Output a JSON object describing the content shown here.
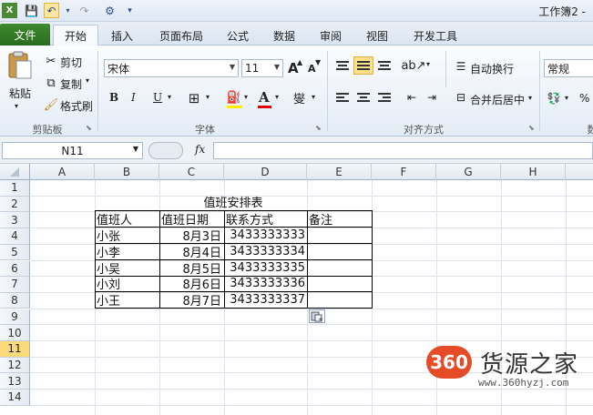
{
  "window": {
    "title": "工作簿2 -"
  },
  "quick_access": {
    "save": "💾",
    "undo": "↶",
    "redo": "↷",
    "extra": "⚙",
    "more": "▾"
  },
  "tabs": [
    {
      "label": "文件"
    },
    {
      "label": "开始"
    },
    {
      "label": "插入"
    },
    {
      "label": "页面布局"
    },
    {
      "label": "公式"
    },
    {
      "label": "数据"
    },
    {
      "label": "审阅"
    },
    {
      "label": "视图"
    },
    {
      "label": "开发工具"
    }
  ],
  "ribbon": {
    "clipboard": {
      "paste": "粘贴",
      "cut": "剪切",
      "copy": "复制",
      "format_painter": "格式刷",
      "group": "剪贴板"
    },
    "font": {
      "name": "宋体",
      "size": "11",
      "group": "字体",
      "bold": "B",
      "italic": "I",
      "underline": "U",
      "grow": "A",
      "shrink": "A",
      "wen": "燮"
    },
    "alignment": {
      "wrap": "自动换行",
      "merge": "合并后居中",
      "group": "对齐方式"
    },
    "number": {
      "format": "常规",
      "percent": "%",
      "group": "数"
    }
  },
  "formula_bar": {
    "name_box": "N11",
    "fx": "fx",
    "value": ""
  },
  "columns": [
    "A",
    "B",
    "C",
    "D",
    "E",
    "F",
    "G",
    "H"
  ],
  "rows": [
    "1",
    "2",
    "3",
    "4",
    "5",
    "6",
    "7",
    "8",
    "9",
    "10",
    "11",
    "12",
    "13",
    "14"
  ],
  "selected_row": "11",
  "sheet": {
    "title": "值班安排表",
    "headers": [
      "值班人",
      "值班日期",
      "联系方式",
      "备注"
    ],
    "records": [
      {
        "name": "小张",
        "date": "8月3日",
        "phone": "3433333333",
        "note": ""
      },
      {
        "name": "小李",
        "date": "8月4日",
        "phone": "3433333334",
        "note": ""
      },
      {
        "name": "小吴",
        "date": "8月5日",
        "phone": "3433333335",
        "note": ""
      },
      {
        "name": "小刘",
        "date": "8月6日",
        "phone": "3433333336",
        "note": ""
      },
      {
        "name": "小王",
        "date": "8月7日",
        "phone": "3433333337",
        "note": ""
      }
    ]
  },
  "watermark": {
    "logo": "360",
    "title": "货源之家",
    "url": "www.360hyzj.com"
  }
}
